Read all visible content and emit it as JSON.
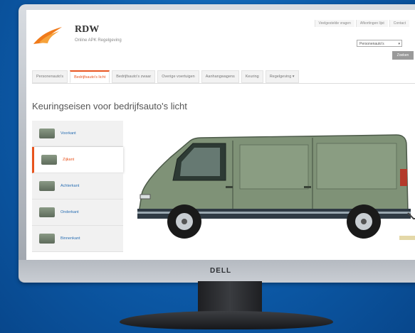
{
  "header": {
    "logo_title": "RDW",
    "logo_subtitle": "Online APK Regelgeving",
    "top_links": [
      "Veelgestelde vragen",
      "Afkortingen lijst",
      "Contact"
    ],
    "select_value": "Personenauto's",
    "zoek_label": "Zoeken"
  },
  "tabs": [
    {
      "label": "Personenauto's",
      "active": false
    },
    {
      "label": "Bedrijfsauto's licht",
      "active": true
    },
    {
      "label": "Bedrijfsauto's zwaar",
      "active": false
    },
    {
      "label": "Overige voertuigen",
      "active": false
    },
    {
      "label": "Aanhangwagens",
      "active": false
    },
    {
      "label": "Keuring",
      "active": false
    },
    {
      "label": "Regelgeving ▾",
      "active": false
    }
  ],
  "page_title": "Keuringseisen voor bedrijfsauto's licht",
  "side_items": [
    {
      "label": "Voorkant",
      "active": false
    },
    {
      "label": "Zijkant",
      "active": true
    },
    {
      "label": "Achterkant",
      "active": false
    },
    {
      "label": "Onderkant",
      "active": false
    },
    {
      "label": "Binnenkant",
      "active": false
    }
  ],
  "monitor_brand": "DELL",
  "colors": {
    "accent": "#e8541e",
    "link": "#2a6fb3",
    "van_body": "#7f9277"
  },
  "icons": [
    "rdw-logo-icon",
    "dropdown-arrow-icon"
  ]
}
